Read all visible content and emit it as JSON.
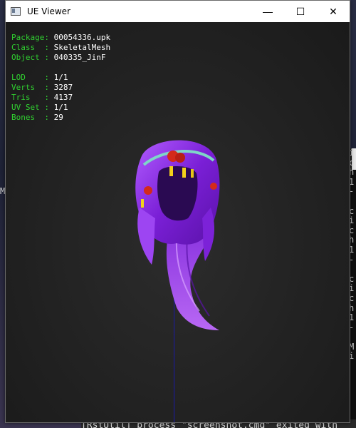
{
  "window": {
    "title": "UE Viewer",
    "minimize_glyph": "—",
    "maximize_glyph": "☐",
    "close_glyph": "✕"
  },
  "info": {
    "package": {
      "key": "Package:",
      "value": "00054336.upk"
    },
    "class": {
      "key": "Class  :",
      "value": "SkeletalMesh"
    },
    "object": {
      "key": "Object :",
      "value": "040335_JinF"
    },
    "lod": {
      "key": "LOD    :",
      "value": "1/1"
    },
    "verts": {
      "key": "Verts  :",
      "value": "3287"
    },
    "tris": {
      "key": "Tris   :",
      "value": "4137"
    },
    "uvset": {
      "key": "UV Set :",
      "value": "1/1"
    },
    "bones": {
      "key": "Bones  :",
      "value": "29"
    }
  },
  "background": {
    "console_lines": [
      "i",
      "c",
      "h",
      "1",
      "-",
      "",
      "c",
      "i",
      "c",
      "h",
      "1",
      "-",
      "",
      "c",
      "i",
      "c",
      "h",
      "1",
      "-",
      "",
      "M",
      "i"
    ],
    "left_char": "M",
    "bottom_text": "[RstUtil] process \"screenshot.cmd\" exited with"
  },
  "colors": {
    "label_green": "#30d030",
    "value_white": "#ffffff",
    "hair_purple": "#8a2be2",
    "accent_red": "#d42a1a",
    "accent_yellow": "#f2d21a",
    "axis_blue": "#1a1aa8"
  }
}
